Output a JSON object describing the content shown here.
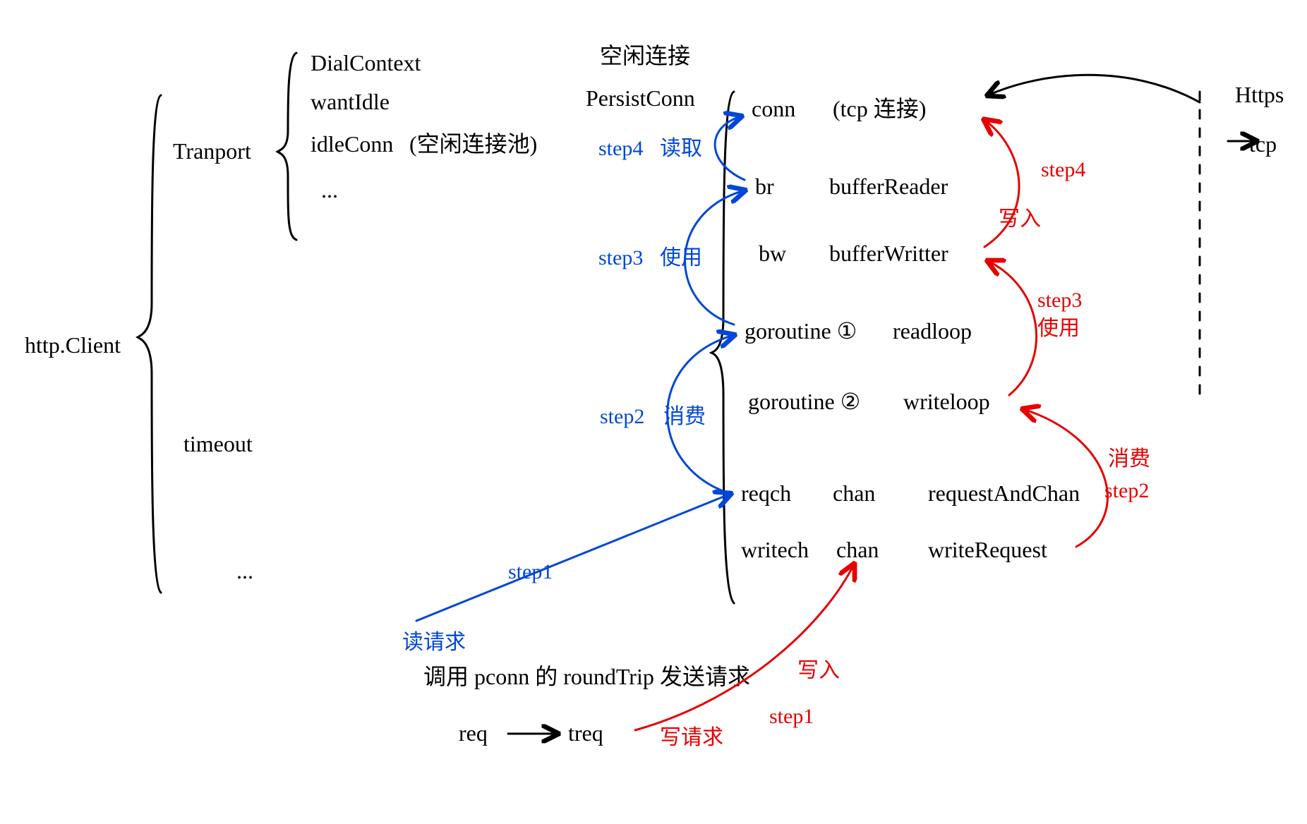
{
  "root": {
    "label": "http.Client"
  },
  "transport": {
    "label": "Tranport",
    "items": {
      "dialContext": "DialContext",
      "wantIdle": "wantIdle",
      "idleConn": "idleConn",
      "idleConnNote": "(空闲连接池)",
      "more": "..."
    }
  },
  "timeout": {
    "label": "timeout",
    "more": "..."
  },
  "persistConn": {
    "header": "空闲连接",
    "label": "PersistConn",
    "fields": {
      "conn": {
        "name": "conn",
        "note": "(tcp 连接)"
      },
      "br": {
        "name": "br",
        "type": "bufferReader"
      },
      "bw": {
        "name": "bw",
        "type": "bufferWritter"
      },
      "readloop": {
        "name": "goroutine ①",
        "type": "readloop"
      },
      "writeloop": {
        "name": "goroutine ②",
        "type": "writeloop"
      },
      "reqch": {
        "name": "reqch",
        "mid": "chan",
        "type": "requestAndChan"
      },
      "writech": {
        "name": "writech",
        "mid": "chan",
        "type": "writeRequest"
      }
    }
  },
  "right": {
    "https": "Https",
    "tcp": "tcp"
  },
  "bottom": {
    "desc": "调用 pconn 的 roundTrip 发送请求",
    "req": "req",
    "arrow": "→",
    "treq": "treq"
  },
  "blueSteps": {
    "s1": {
      "label": "step1",
      "note": "读请求"
    },
    "s2": {
      "label": "step2",
      "note": "消费"
    },
    "s3": {
      "label": "step3",
      "note": "使用"
    },
    "s4": {
      "label": "step4",
      "note": "读取"
    }
  },
  "redSteps": {
    "s1": {
      "label": "step1",
      "note": "写请求",
      "action": "写入"
    },
    "s2": {
      "label": "step2",
      "note": "消费"
    },
    "s3": {
      "label": "step3",
      "note": "使用"
    },
    "s4": {
      "label": "step4",
      "note": "写入"
    }
  }
}
